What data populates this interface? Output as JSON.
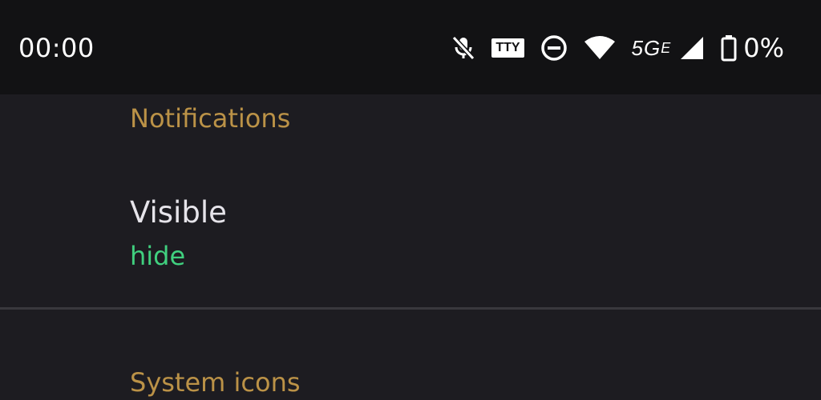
{
  "status_bar": {
    "time": "00:00",
    "tty_label": "TTY",
    "network_type": "5G",
    "network_suffix": "E",
    "battery_percent": "0%",
    "icons": [
      "mic-off-icon",
      "tty-icon",
      "do-not-disturb-icon",
      "wifi-icon",
      "network-5ge-icon",
      "cell-signal-icon",
      "battery-icon"
    ]
  },
  "sections": {
    "notifications": {
      "header": "Notifications",
      "preference": {
        "title": "Visible",
        "summary": "hide"
      }
    },
    "system_icons": {
      "header": "System icons"
    }
  },
  "colors": {
    "background": "#1d1c21",
    "status_bar": "#121214",
    "section_header": "#bb9247",
    "summary_accent": "#40d07f",
    "title_text": "#e6e4ea"
  }
}
